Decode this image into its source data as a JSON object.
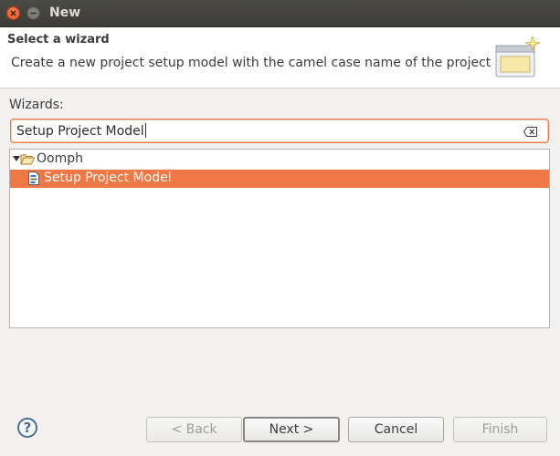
{
  "window": {
    "title": "New",
    "close_icon": "close-icon",
    "minimize_icon": "minimize-icon"
  },
  "header": {
    "title": "Select a wizard",
    "description": "Create a new project setup model with the camel case name of the project",
    "banner_icon": "new-wizard-banner-icon"
  },
  "wizards_label": "Wizards:",
  "filter": {
    "value": "Setup Project Model",
    "clear_icon": "clear-icon"
  },
  "tree": {
    "items": [
      {
        "label": "Oomph",
        "icon": "folder-open-icon",
        "expanded": true,
        "selected": false
      },
      {
        "label": "Setup Project Model",
        "icon": "setup-model-icon",
        "selected": true
      }
    ],
    "selection_color": "#f07746"
  },
  "buttons": {
    "back": "< Back",
    "next": "Next >",
    "cancel": "Cancel",
    "finish": "Finish",
    "help_icon": "help-icon"
  },
  "colors": {
    "accent": "#f07746",
    "titlebar": "#3d3c38"
  }
}
